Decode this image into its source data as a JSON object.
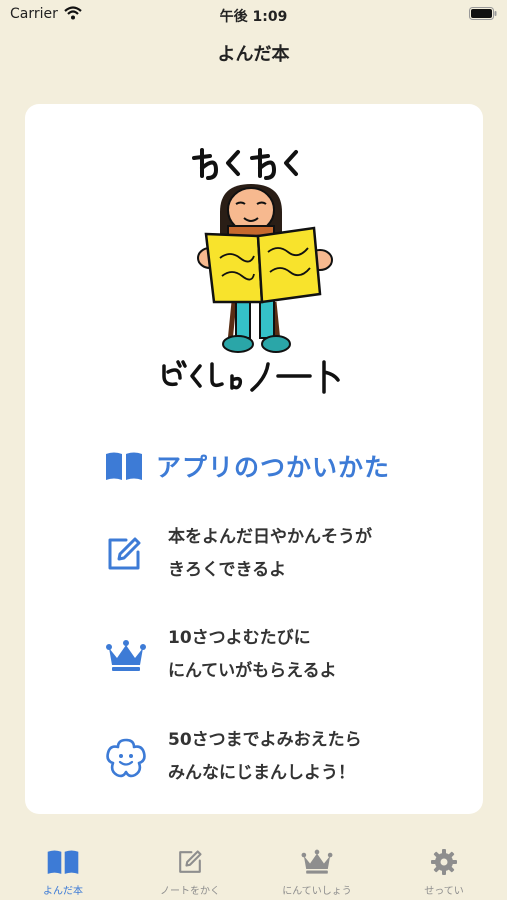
{
  "status_bar": {
    "carrier": "Carrier",
    "time": "午後 1:09"
  },
  "nav": {
    "title": "よんだ本"
  },
  "howto": {
    "title": "アプリのつかいかた"
  },
  "features": [
    {
      "icon": "edit-note-icon",
      "lines": [
        "本をよんだ日やかんそうが",
        "きろくできるよ"
      ]
    },
    {
      "icon": "crown-icon",
      "lines": [
        "10さつよむたびに",
        "にんていがもらえるよ"
      ]
    },
    {
      "icon": "smiling-flower-icon",
      "lines": [
        "50さつまでよみおえたら",
        "みんなにじまんしよう！"
      ]
    }
  ],
  "tabs": [
    {
      "label": "よんだ本",
      "icon": "open-book-icon",
      "active": true
    },
    {
      "label": "ノートをかく",
      "icon": "edit-note-icon",
      "active": false
    },
    {
      "label": "にんていしょう",
      "icon": "crown-icon",
      "active": false
    },
    {
      "label": "せってい",
      "icon": "gear-icon",
      "active": false
    }
  ],
  "colors": {
    "accent": "#3D7BD6",
    "background": "#F3EEDC",
    "inactive": "#8E8E8E"
  }
}
